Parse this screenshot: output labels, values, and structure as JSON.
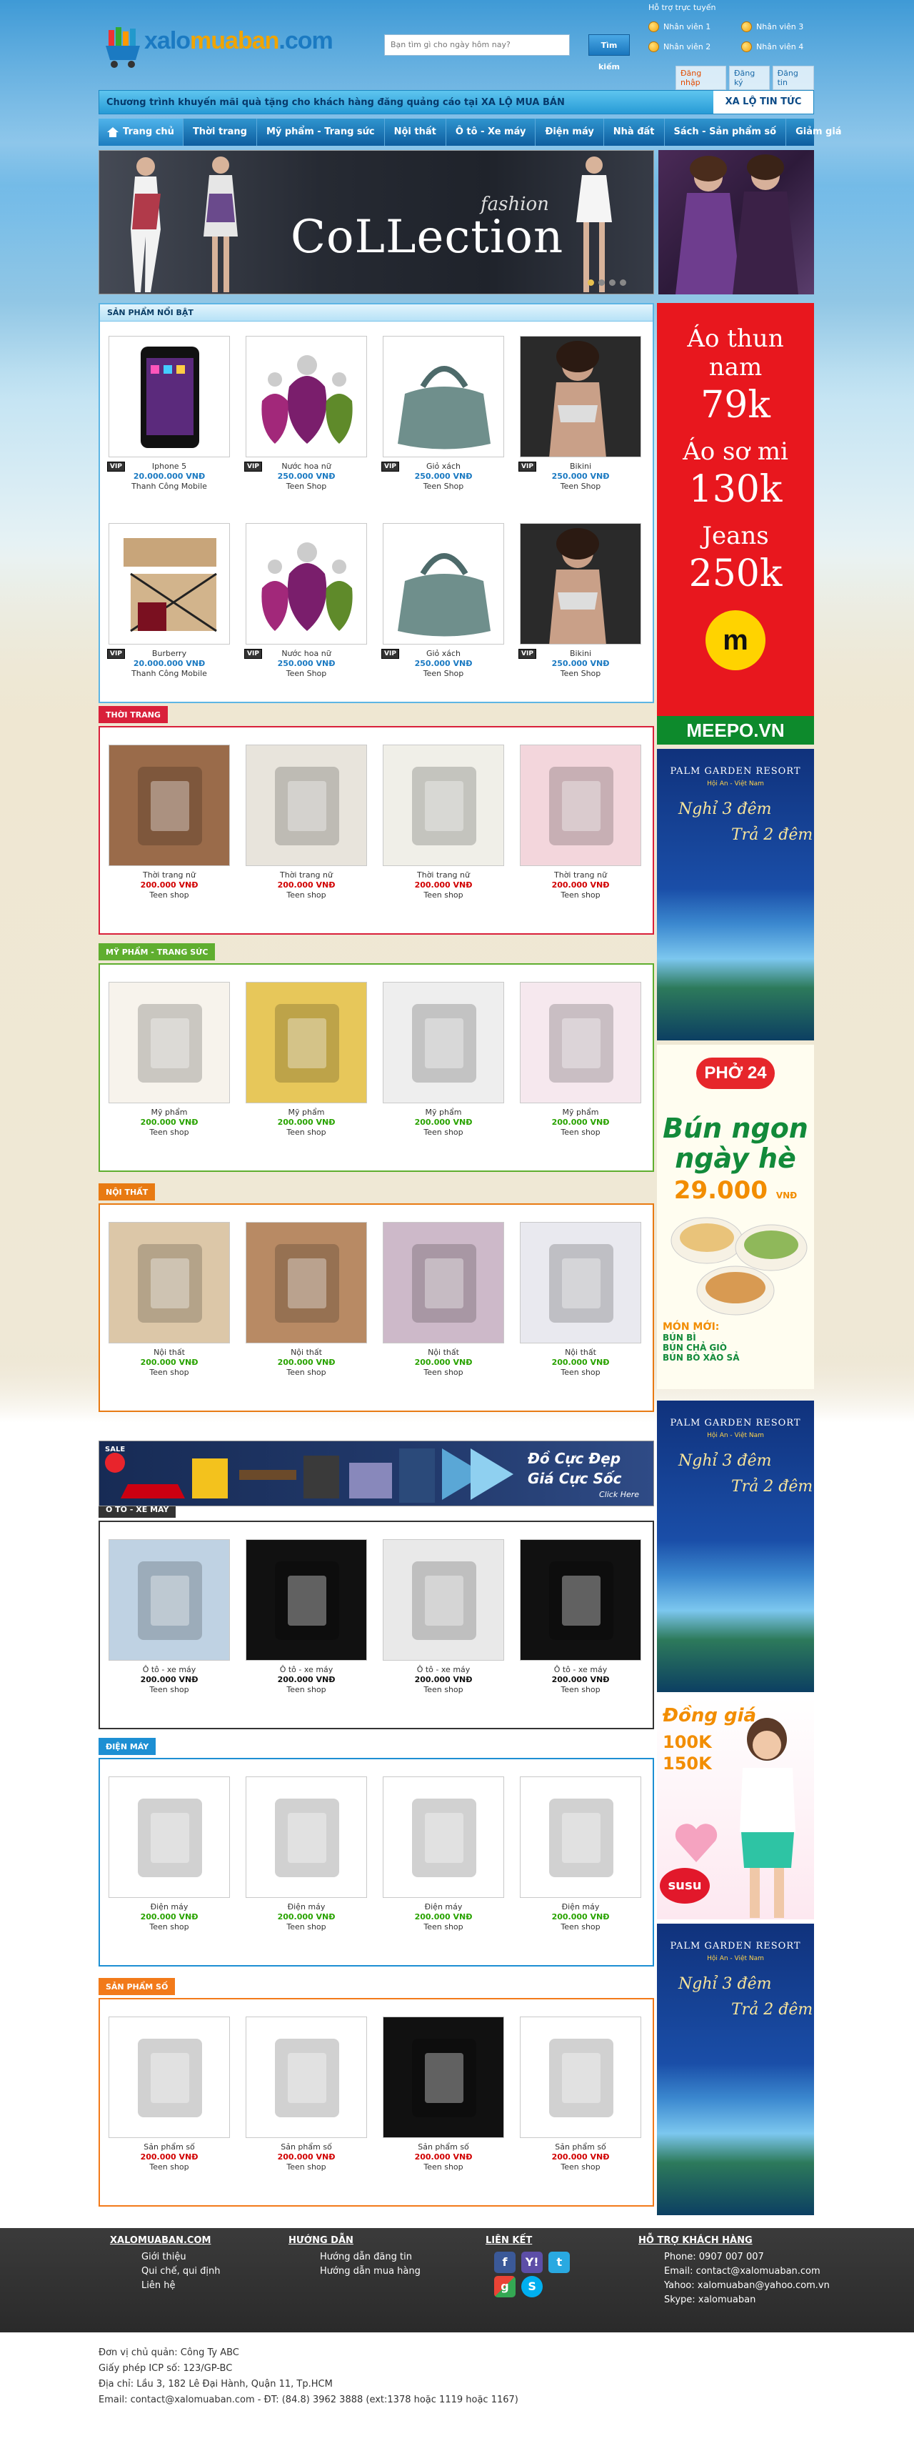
{
  "header": {
    "logo_text_1": "xalo",
    "logo_text_2": "muaban",
    "logo_text_3": ".com",
    "search_placeholder": "Bạn tìm gì cho ngày hôm nay?",
    "search_button": "Tìm kiếm",
    "support_title": "Hỗ trợ trực tuyến",
    "support": [
      "Nhân viên 1",
      "Nhân viên 3",
      "Nhân viên 2",
      "Nhân viên 4"
    ],
    "account": [
      "Đăng nhập",
      "Đăng ký",
      "Đăng tin"
    ]
  },
  "announcement": {
    "text": "Chương trình khuyến mãi quà tặng cho khách hàng đăng quảng cáo tại XA LỘ MUA BÁN",
    "tab": "XA LỘ TIN TỨC"
  },
  "nav": [
    "Trang chủ",
    "Thời trang",
    "Mỹ phẩm - Trang sức",
    "Nội thất",
    "Ô tô - Xe máy",
    "Điện máy",
    "Nhà đất",
    "Sách - Sản phẩm số",
    "Giảm giá"
  ],
  "slider": {
    "fashion": "fashion",
    "collection": "CoLLection"
  },
  "featured": {
    "title": "SẢN PHẨM NỔI BẬT",
    "vip": "VIP",
    "rows": [
      [
        {
          "name": "Iphone 5",
          "price": "20.000.000 VNĐ",
          "shop": "Thanh Công Mobile"
        },
        {
          "name": "Nước hoa nữ",
          "price": "250.000 VNĐ",
          "shop": "Teen Shop"
        },
        {
          "name": "Giỏ xách",
          "price": "250.000 VNĐ",
          "shop": "Teen Shop"
        },
        {
          "name": "Bikini",
          "price": "250.000 VNĐ",
          "shop": "Teen Shop"
        }
      ],
      [
        {
          "name": "Burberry",
          "price": "20.000.000 VNĐ",
          "shop": "Thanh Công Mobile"
        },
        {
          "name": "Nước hoa nữ",
          "price": "250.000 VNĐ",
          "shop": "Teen Shop"
        },
        {
          "name": "Giỏ xách",
          "price": "250.000 VNĐ",
          "shop": "Teen Shop"
        },
        {
          "name": "Bikini",
          "price": "250.000 VNĐ",
          "shop": "Teen Shop"
        }
      ]
    ]
  },
  "sections": [
    {
      "title": "THỜI TRANG",
      "color": "#d9203a",
      "items": [
        {
          "name": "Thời trang nữ",
          "price": "200.000 VNĐ",
          "shop": "Teen shop"
        },
        {
          "name": "Thời trang nữ",
          "price": "200.000 VNĐ",
          "shop": "Teen shop"
        },
        {
          "name": "Thời trang nữ",
          "price": "200.000 VNĐ",
          "shop": "Teen shop"
        },
        {
          "name": "Thời trang nữ",
          "price": "200.000 VNĐ",
          "shop": "Teen shop"
        }
      ]
    },
    {
      "title": "MỸ PHẨM - TRANG SỨC",
      "color": "#5fae2f",
      "items": [
        {
          "name": "Mỹ phẩm",
          "price": "200.000 VNĐ",
          "shop": "Teen shop"
        },
        {
          "name": "Mỹ phẩm",
          "price": "200.000 VNĐ",
          "shop": "Teen shop"
        },
        {
          "name": "Mỹ phẩm",
          "price": "200.000 VNĐ",
          "shop": "Teen shop"
        },
        {
          "name": "Mỹ phẩm",
          "price": "200.000 VNĐ",
          "shop": "Teen shop"
        }
      ]
    },
    {
      "title": "NỘI THẤT",
      "color": "#e87a12",
      "items": [
        {
          "name": "Nội thất",
          "price": "200.000 VNĐ",
          "shop": "Teen shop"
        },
        {
          "name": "Nội thất",
          "price": "200.000 VNĐ",
          "shop": "Teen shop"
        },
        {
          "name": "Nội thất",
          "price": "200.000 VNĐ",
          "shop": "Teen shop"
        },
        {
          "name": "Nội thất",
          "price": "200.000 VNĐ",
          "shop": "Teen shop"
        }
      ]
    },
    {
      "title": "Ô TÔ - XE MÁY",
      "color": "#333333",
      "items": [
        {
          "name": "Ô tô - xe máy",
          "price": "200.000 VNĐ",
          "shop": "Teen shop"
        },
        {
          "name": "Ô tô - xe máy",
          "price": "200.000 VNĐ",
          "shop": "Teen shop"
        },
        {
          "name": "Ô tô - xe máy",
          "price": "200.000 VNĐ",
          "shop": "Teen shop"
        },
        {
          "name": "Ô tô - xe máy",
          "price": "200.000 VNĐ",
          "shop": "Teen shop"
        }
      ]
    },
    {
      "title": "ĐIỆN MÁY",
      "color": "#1d8fd3",
      "items": [
        {
          "name": "Điện máy",
          "price": "200.000 VNĐ",
          "shop": "Teen shop"
        },
        {
          "name": "Điện máy",
          "price": "200.000 VNĐ",
          "shop": "Teen shop"
        },
        {
          "name": "Điện máy",
          "price": "200.000 VNĐ",
          "shop": "Teen shop"
        },
        {
          "name": "Điện máy",
          "price": "200.000 VNĐ",
          "shop": "Teen shop"
        }
      ]
    },
    {
      "title": "SẢN PHẨM SỐ",
      "color": "#f27a1a",
      "items": [
        {
          "name": "Sản phẩm số",
          "price": "200.000 VNĐ",
          "shop": "Teen shop"
        },
        {
          "name": "Sản phẩm số",
          "price": "200.000 VNĐ",
          "shop": "Teen shop"
        },
        {
          "name": "Sản phẩm số",
          "price": "200.000 VNĐ",
          "shop": "Teen shop"
        },
        {
          "name": "Sản phẩm số",
          "price": "200.000 VNĐ",
          "shop": "Teen shop"
        }
      ]
    }
  ],
  "promo_banner": {
    "line1": "Đồ Cực Đẹp",
    "line2": "Giá Cực Sốc",
    "line3": "Click Here",
    "sale": "SALE"
  },
  "ads": {
    "meepo": {
      "l1": "Áo thun nam",
      "p1": "79k",
      "l2": "Áo sơ mi",
      "p2": "130k",
      "l3": "Jeans",
      "p3": "250k",
      "brand": "MEEPO.VN",
      "logo": "meepo"
    },
    "resort": {
      "title": "PALM GARDEN RESORT",
      "sub": "Hội An - Việt Nam",
      "l1": "Nghỉ 3 đêm",
      "l2": "Trả 2 đêm"
    },
    "pho": {
      "brand": "PHỞ 24",
      "l1": "Bún ngon",
      "l2": "ngày hè",
      "price": "29.000",
      "unit": "VNĐ",
      "new": "MÓN MỚI:",
      "m1": "BÚN BÌ",
      "m2": "BÚN CHẢ GIÒ",
      "m3": "BÚN BÒ XÀO SẢ"
    },
    "susu": {
      "l1": "Đồng giá",
      "l2": "100K",
      "l3": "150K",
      "brand": "susu"
    }
  },
  "footer": {
    "cols": [
      {
        "title": "XALOMUABAN.COM",
        "links": [
          "Giới thiệu",
          "Qui chế, qui định",
          "Liên hệ"
        ]
      },
      {
        "title": "HƯỚNG DẪN",
        "links": [
          "Hướng dẫn đăng tin",
          "Hướng dẫn mua hàng"
        ]
      },
      {
        "title": "LIÊN KẾT",
        "links": []
      },
      {
        "title": "HỖ TRỢ KHÁCH HÀNG",
        "links": [
          "Phone: 0907 007 007",
          "Email: contact@xalomuaban.com",
          "Yahoo: xalomuaban@yahoo.com.vn",
          "Skype: xalomuaban"
        ]
      }
    ],
    "info": [
      "Đơn vị chủ quản: Công Ty ABC",
      "Giấy phép ICP số: 123/GP-BC",
      "Địa chỉ: Lầu 3, 182 Lê Đại Hành, Quận 11, Tp.HCM",
      "Email: contact@xalomuaban.com - ĐT: (84.8) 3962 3888 (ext:1378 hoặc 1119 hoặc 1167)"
    ]
  }
}
